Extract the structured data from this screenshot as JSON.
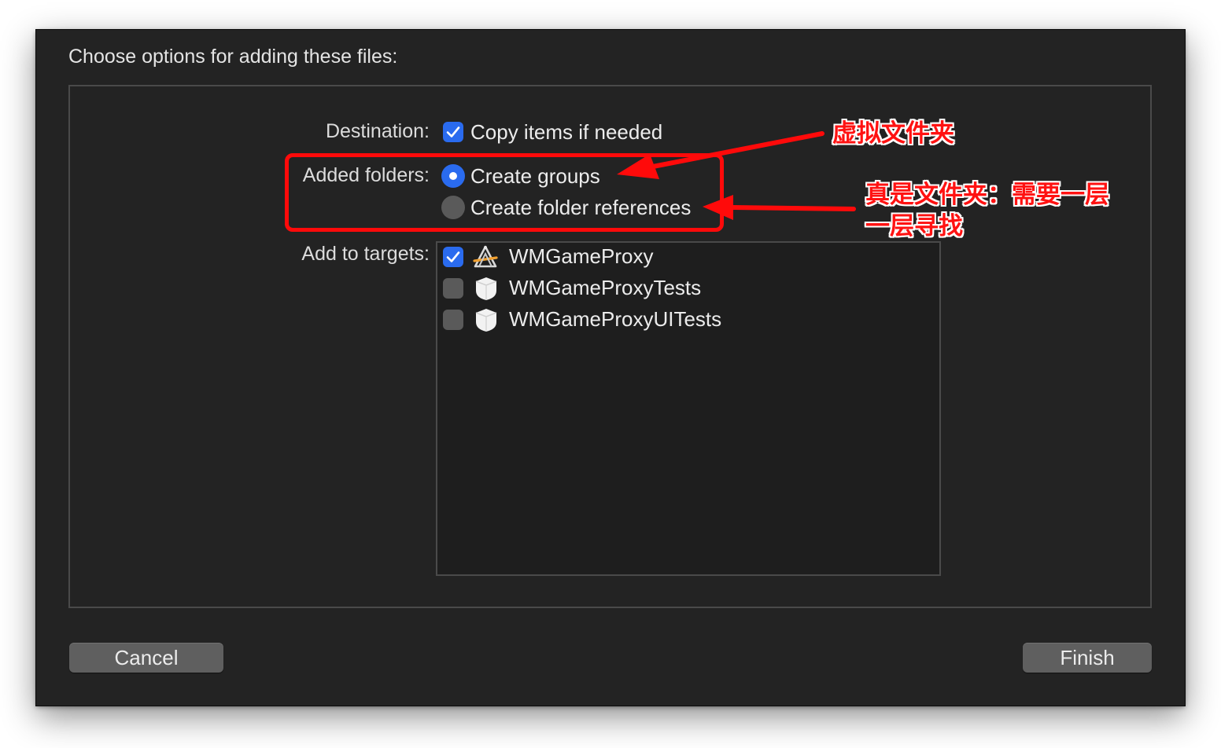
{
  "dialog": {
    "title": "Choose options for adding these files:",
    "destination": {
      "label": "Destination:",
      "option": "Copy items if needed",
      "checked": true
    },
    "added_folders": {
      "label": "Added folders:",
      "options": [
        {
          "label": "Create groups",
          "selected": true
        },
        {
          "label": "Create folder references",
          "selected": false
        }
      ]
    },
    "targets": {
      "label": "Add to targets:",
      "items": [
        {
          "name": "WMGameProxy",
          "checked": true,
          "icon": "app-target-icon"
        },
        {
          "name": "WMGameProxyTests",
          "checked": false,
          "icon": "test-bundle-icon"
        },
        {
          "name": "WMGameProxyUITests",
          "checked": false,
          "icon": "test-bundle-icon"
        }
      ]
    },
    "buttons": {
      "cancel": "Cancel",
      "finish": "Finish"
    }
  },
  "annotations": {
    "groups_note": "虚拟文件夹",
    "references_note_line1": "真是文件夹：需要一层",
    "references_note_line2": "一层寻找",
    "color": "#ff0a0a"
  },
  "colors": {
    "accent": "#2a6bef",
    "background": "#232323"
  }
}
